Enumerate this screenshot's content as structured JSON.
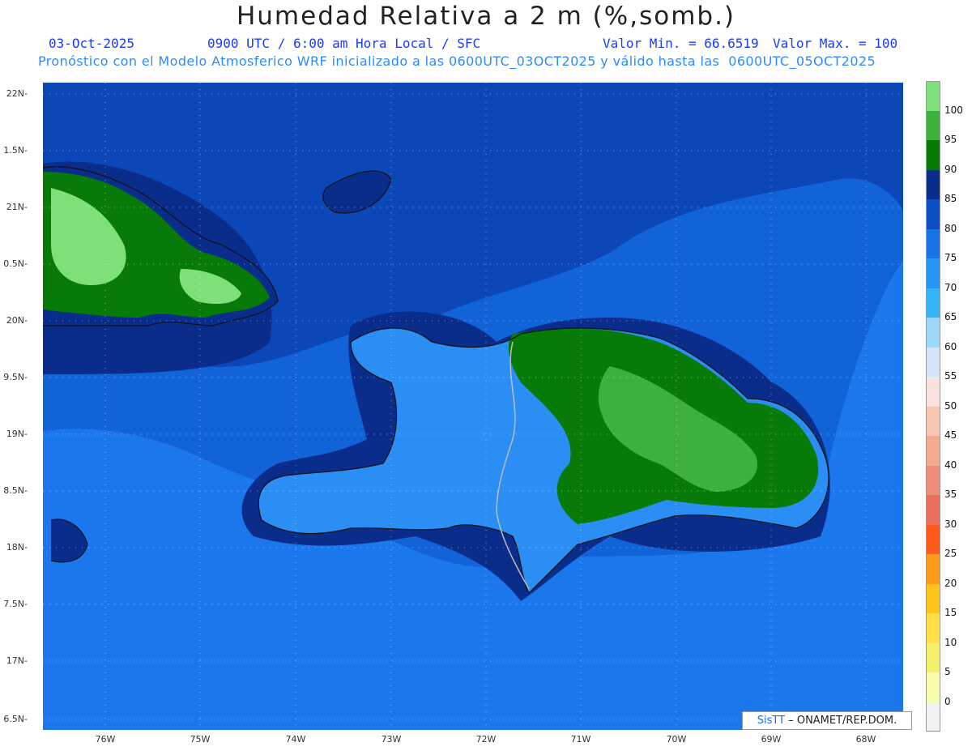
{
  "title": "Humedad Relativa a 2 m (%,somb.)",
  "date": "03-Oct-2025",
  "time_info": "0900 UTC / 6:00 am Hora Local / SFC",
  "min_value": "Valor Min. = 66.6519",
  "max_value": "Valor Max. = 100",
  "forecast_info": "Pronóstico con el Modelo Atmosferico WRF inicializado a las 0600UTC_03OCT2025 y válido hasta las  0600UTC_05OCT2025",
  "credit": {
    "brand": "SisTT",
    "text": "– ONAMET/REP.DOM."
  },
  "lat_labels": [
    "22N",
    "1.5N",
    "21N",
    "0.5N",
    "20N",
    "9.5N",
    "19N",
    "8.5N",
    "18N",
    "7.5N",
    "17N",
    "6.5N"
  ],
  "lon_labels": [
    "76W",
    "75W",
    "74W",
    "73W",
    "72W",
    "71W",
    "70W",
    "69W",
    "68W"
  ],
  "colorbar": {
    "labels": [
      "100",
      "95",
      "90",
      "85",
      "80",
      "75",
      "70",
      "65",
      "60",
      "55",
      "50",
      "45",
      "40",
      "35",
      "30",
      "25",
      "20",
      "15",
      "10",
      "5",
      "0"
    ],
    "colors": [
      "#7fe07a",
      "#3db03d",
      "#087a08",
      "#0a2d8c",
      "#0d4fc4",
      "#1673e6",
      "#2793f2",
      "#35b4fa",
      "#9dd8fb",
      "#d6e4f9",
      "#fae0df",
      "#f6c6b0",
      "#f3aa90",
      "#ef8e78",
      "#ea6f5b",
      "#ff5a1a",
      "#ff9a1a",
      "#ffc41a",
      "#ffe046",
      "#f4f06e",
      "#fbfbb0",
      "#f2f2f2"
    ]
  },
  "map_colors": {
    "ocean_dark": "#0c47b8",
    "ocean_mid": "#1262d8",
    "ocean_light": "#1a78ec",
    "land_dark": "#0a2d8c",
    "land_light": "#2b8ef5",
    "green_dark": "#087a08",
    "green_mid": "#3db03d",
    "green_light": "#7fe07a"
  }
}
